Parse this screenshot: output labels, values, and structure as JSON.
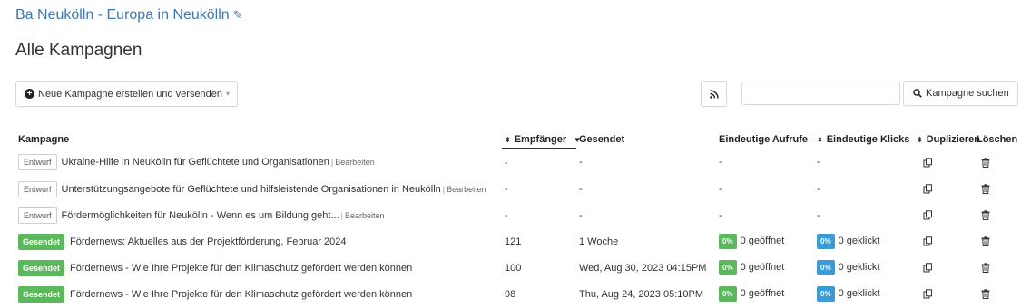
{
  "header": {
    "list_name": "Ba Neukölln - Europa in Neukölln",
    "page_title": "Alle Kampagnen"
  },
  "toolbar": {
    "new_campaign_label": "Neue Kampagne erstellen und versenden",
    "search_placeholder": "",
    "search_button_label": "Kampagne suchen"
  },
  "table": {
    "columns": {
      "campaign": "Kampagne",
      "recipients": "Empfänger",
      "sent": "Gesendet",
      "unique_opens": "Eindeutige Aufrufe",
      "unique_clicks": "Eindeutige Klicks",
      "duplicate": "Duplizieren",
      "delete": "Löschen"
    },
    "sort": {
      "column": "recipients",
      "direction": "descending"
    },
    "edit_label": "Bearbeiten",
    "rows": [
      {
        "status": "Entwurf",
        "status_type": "draft",
        "name": "Ukraine-Hilfe in Neukölln für Geflüchtete und Organisationen",
        "recipients": "-",
        "sent": "-",
        "opens_pct": "",
        "opens": "-",
        "clicks_pct": "",
        "clicks": "-"
      },
      {
        "status": "Entwurf",
        "status_type": "draft",
        "name": "Unterstützungsangebote für Geflüchtete und hilfsleistende Organisationen in Neukölln",
        "recipients": "-",
        "sent": "-",
        "opens_pct": "",
        "opens": "-",
        "clicks_pct": "",
        "clicks": "-"
      },
      {
        "status": "Entwurf",
        "status_type": "draft",
        "name": "Fördermöglichkeiten für Neukölln - Wenn es um Bildung geht...",
        "recipients": "-",
        "sent": "-",
        "opens_pct": "",
        "opens": "-",
        "clicks_pct": "",
        "clicks": "-"
      },
      {
        "status": "Gesendet",
        "status_type": "sent",
        "name": "Fördernews: Aktuelles aus der Projektförderung, Februar 2024",
        "recipients": "121",
        "sent": "1 Woche",
        "opens_pct": "0%",
        "opens": "0 geöffnet",
        "clicks_pct": "0%",
        "clicks": "0 geklickt"
      },
      {
        "status": "Gesendet",
        "status_type": "sent",
        "name": "Fördernews - Wie Ihre Projekte für den Klimaschutz gefördert werden können",
        "recipients": "100",
        "sent": "Wed, Aug 30, 2023 04:15PM",
        "opens_pct": "0%",
        "opens": "0 geöffnet",
        "clicks_pct": "0%",
        "clicks": "0 geklickt"
      },
      {
        "status": "Gesendet",
        "status_type": "sent",
        "name": "Fördernews - Wie Ihre Projekte für den Klimaschutz gefördert werden können",
        "recipients": "98",
        "sent": "Thu, Aug 24, 2023 05:10PM",
        "opens_pct": "0%",
        "opens": "0 geöffnet",
        "clicks_pct": "0%",
        "clicks": "0 geklickt"
      }
    ]
  },
  "icons": {
    "edit_title": "pencil-icon",
    "new_campaign": "plus-circle-icon",
    "rss": "rss-icon",
    "search": "search-icon",
    "duplicate": "duplicate-icon",
    "delete": "trash-icon"
  },
  "colors": {
    "link": "#3d78b4",
    "sent_badge": "#5cb85c",
    "open_badge": "#5cb85c",
    "click_badge": "#3a9bd5"
  }
}
